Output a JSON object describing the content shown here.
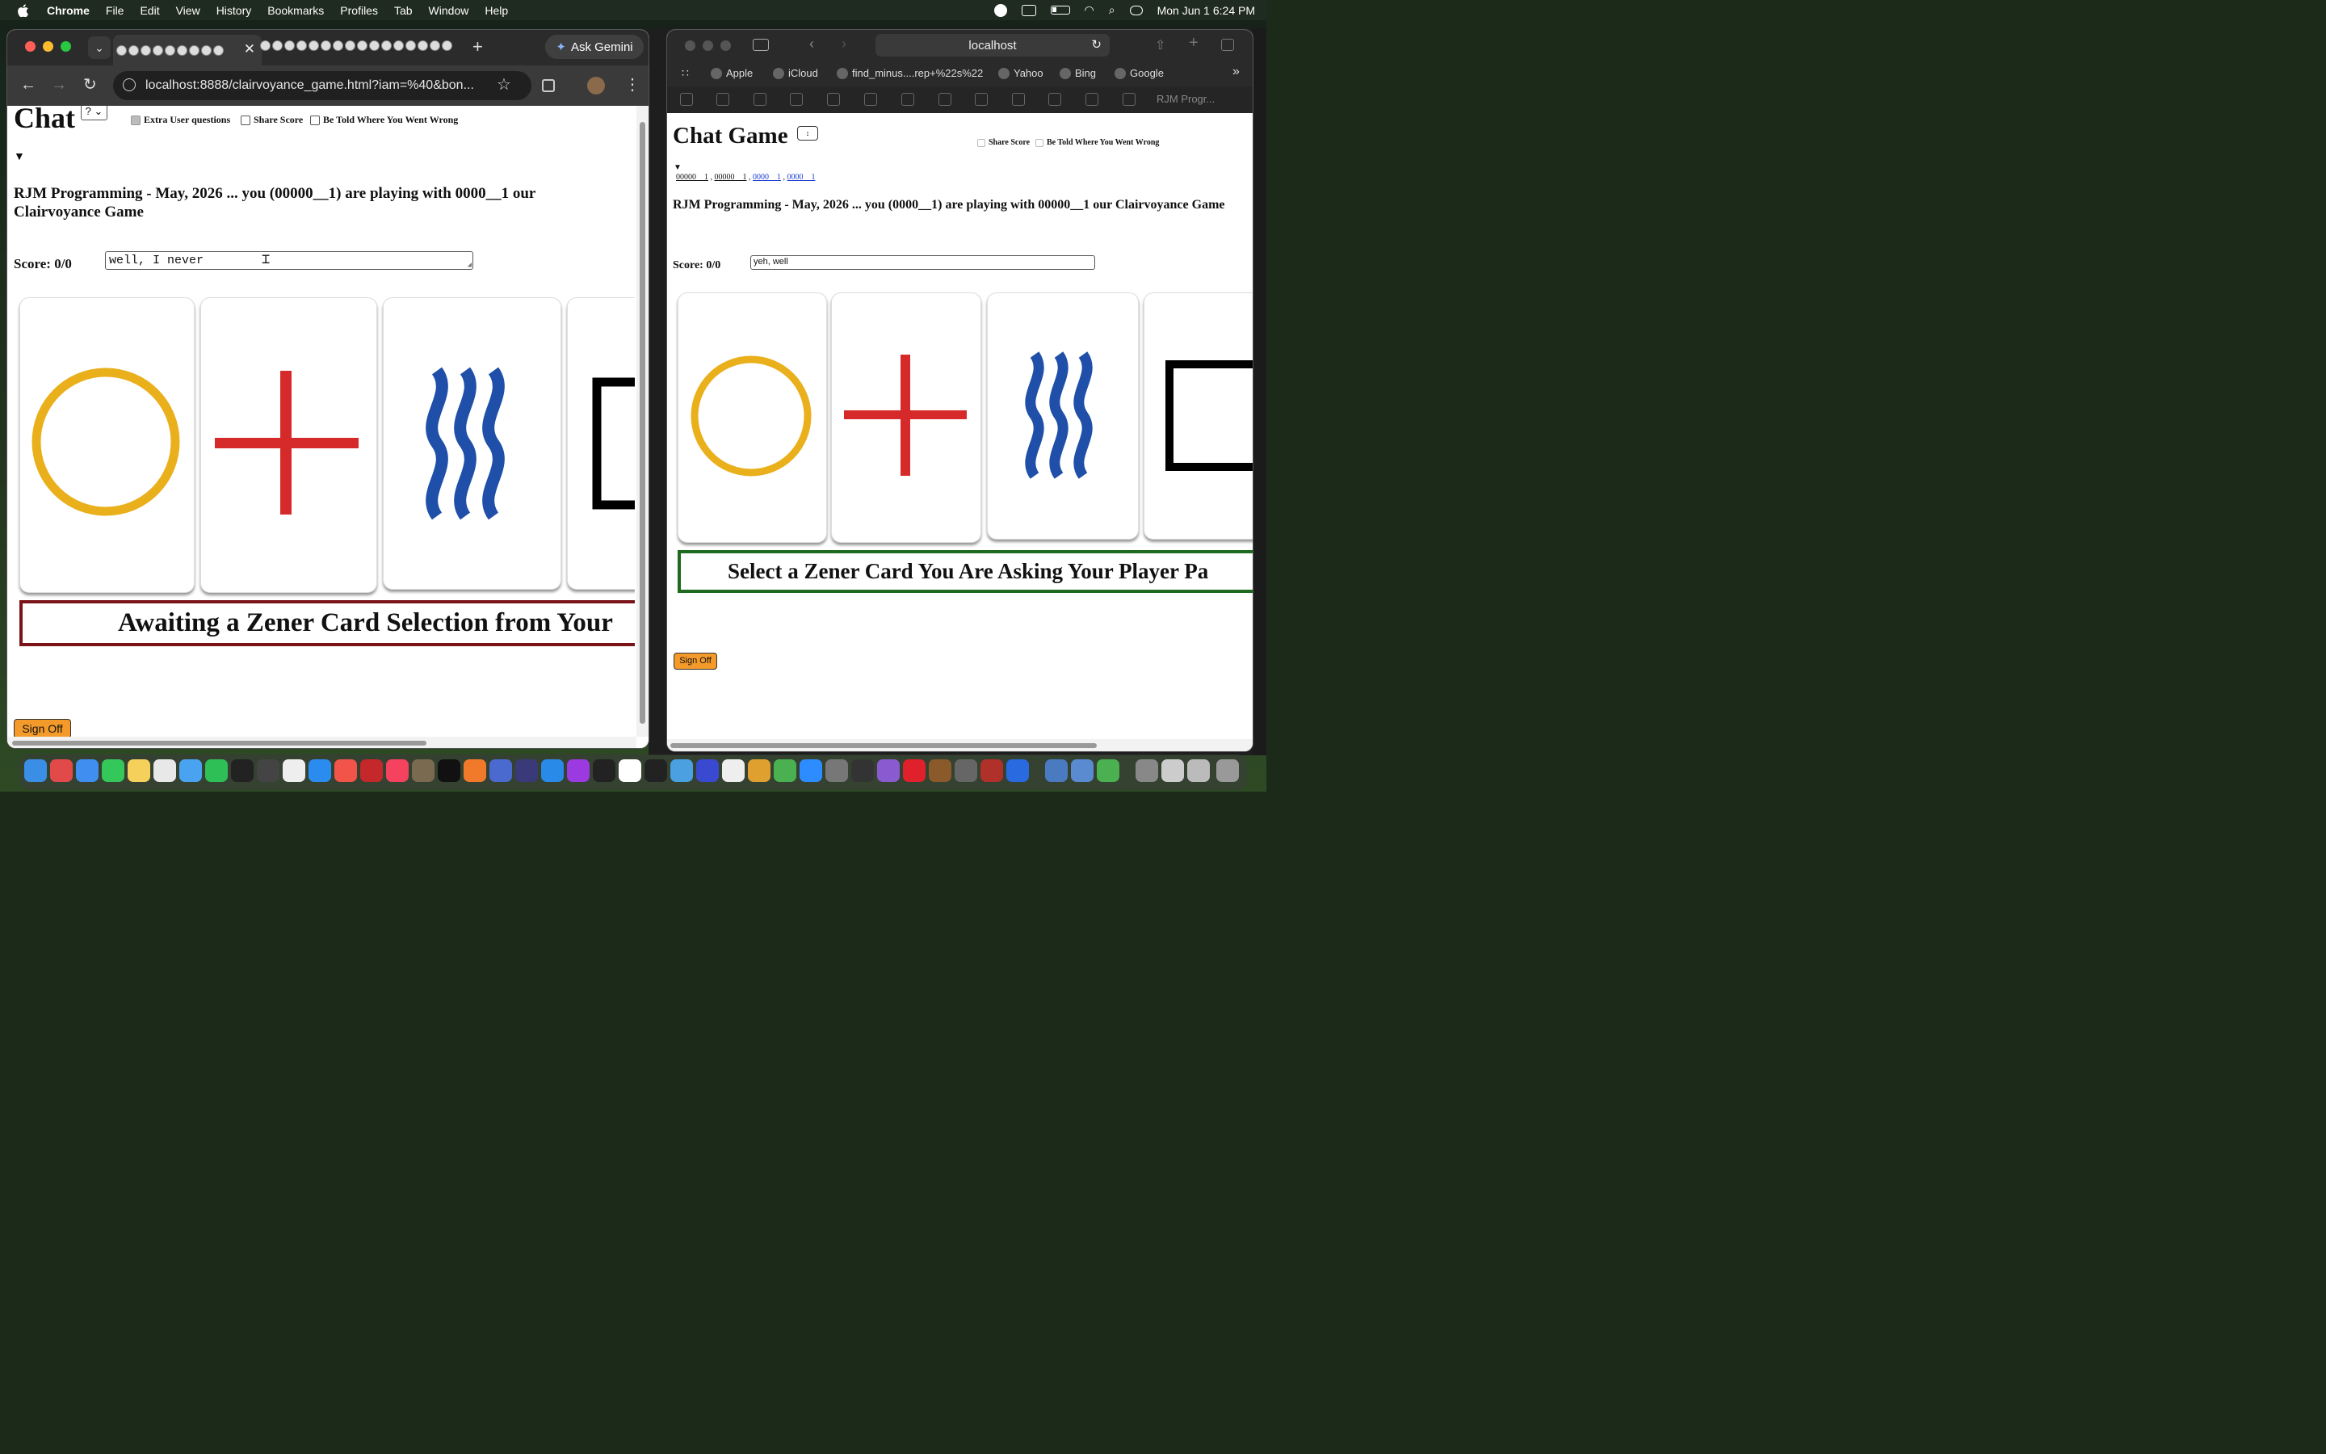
{
  "menubar": {
    "app_name": "Chrome",
    "menus": [
      "File",
      "Edit",
      "View",
      "History",
      "Bookmarks",
      "Profiles",
      "Tab",
      "Window",
      "Help"
    ],
    "datetime": "Mon Jun 1  6:24 PM"
  },
  "chrome": {
    "ask_gemini": "Ask Gemini",
    "url": "localhost:8888/clairvoyance_game.html?iam=%40&bon...",
    "page": {
      "title": "Chat",
      "select_value": "?",
      "checkboxes": [
        {
          "label": "Extra User questions",
          "checked": true
        },
        {
          "label": "Share Score",
          "checked": false
        },
        {
          "label": "Be Told Where You Went Wrong",
          "checked": false
        }
      ],
      "toggle": "▼",
      "heading": "RJM Programming - May, 2026 ... you (00000__1) are playing with 0000__1 our Clairvoyance Game",
      "score": "Score: 0/0",
      "message": "well, I never",
      "status": "Awaiting a Zener Card Selection from Your",
      "sign_off": "Sign Off"
    }
  },
  "safari": {
    "url": "localhost",
    "bookmarks": [
      "Apple",
      "iCloud",
      "find_minus....rep+%22s%22",
      "Yahoo",
      "Bing",
      "Google"
    ],
    "tab_label": "RJM Progr...",
    "page": {
      "title": "Chat Game",
      "checkboxes": [
        {
          "label": "Share Score",
          "checked": false
        },
        {
          "label": "Be Told Where You Went Wrong",
          "checked": false
        }
      ],
      "player_links": [
        "00000__1",
        "00000__1",
        "0000__1",
        "0000__1"
      ],
      "heading": "RJM Programming - May, 2026 ... you (0000__1) are playing with 00000__1 our Clairvoyance Game",
      "score": "Score: 0/0",
      "message": "yeh, well",
      "status": "Select a Zener Card You Are Asking Your Player Pa",
      "sign_off": "Sign Off"
    }
  },
  "cards": [
    "circle",
    "cross",
    "waves",
    "square"
  ],
  "colors": {
    "circle": "#e9b01c",
    "cross": "#d62a2a",
    "waves": "#1f4fa8",
    "square": "#000000",
    "status_border_chrome": "#7a1418",
    "status_border_safari": "#1e6a1e",
    "sign_off_bg": "#f39a2a"
  }
}
